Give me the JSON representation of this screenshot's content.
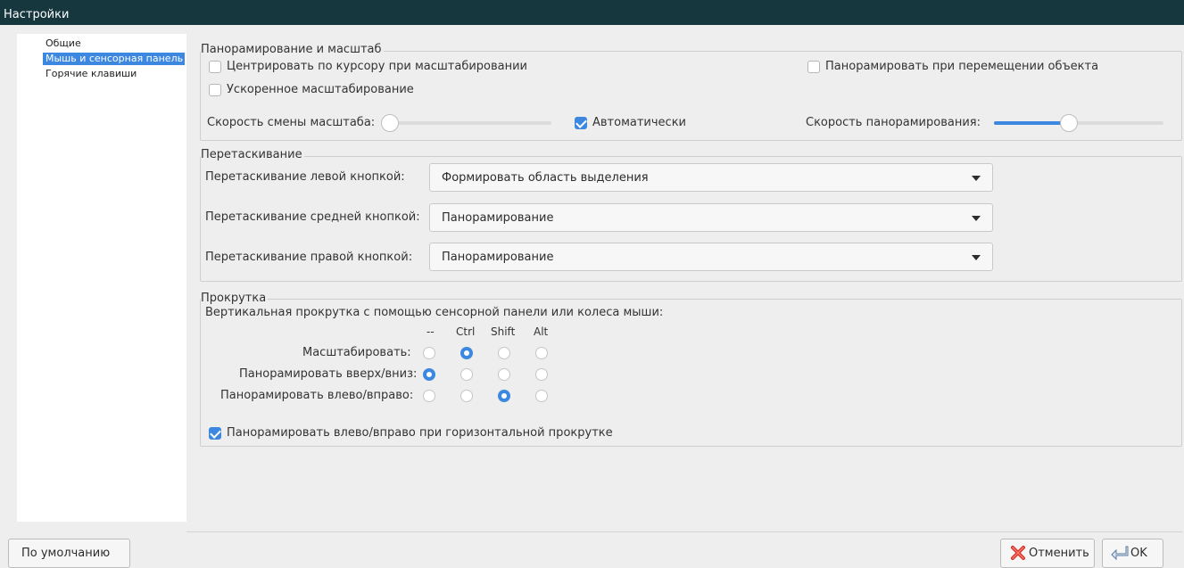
{
  "window": {
    "title": "Настройки"
  },
  "sidebar": {
    "items": [
      {
        "label": "Общие",
        "selected": false
      },
      {
        "label": "Мышь и сенсорная панель",
        "selected": true
      },
      {
        "label": "Горячие клавиши",
        "selected": false
      }
    ]
  },
  "pan_zoom": {
    "title": "Панорамирование и масштаб",
    "center_on_cursor": {
      "label": "Центрировать по курсору при масштабировании",
      "checked": false
    },
    "pan_on_move": {
      "label": "Панорамировать при перемещении объекта",
      "checked": false
    },
    "accelerated_zoom": {
      "label": "Ускоренное масштабирование",
      "checked": false
    },
    "zoom_speed": {
      "label": "Скорость смены масштаба:",
      "value": 0.0
    },
    "auto": {
      "label": "Автоматически",
      "checked": true
    },
    "pan_speed": {
      "label": "Скорость панорамирования:",
      "value": 0.45
    }
  },
  "drag": {
    "title": "Перетаскивание",
    "left": {
      "label": "Перетаскивание левой кнопкой:",
      "value": "Формировать область выделения"
    },
    "middle": {
      "label": "Перетаскивание средней кнопкой:",
      "value": "Панорамирование"
    },
    "right": {
      "label": "Перетаскивание правой кнопкой:",
      "value": "Панорамирование"
    }
  },
  "scroll": {
    "title": "Прокрутка",
    "subtitle": "Вертикальная прокрутка с помощью сенсорной панели или колеса мыши:",
    "columns": [
      "--",
      "Ctrl",
      "Shift",
      "Alt"
    ],
    "rows": [
      {
        "label": "Масштабировать:",
        "selected": 1
      },
      {
        "label": "Панорамировать вверх/вниз:",
        "selected": 0
      },
      {
        "label": "Панорамировать влево/вправо:",
        "selected": 2
      }
    ],
    "horizontal": {
      "label": "Панорамировать влево/вправо при горизонтальной прокрутке",
      "checked": true
    }
  },
  "buttons": {
    "defaults": "По умолчанию",
    "cancel": "Отменить",
    "ok": "OK"
  },
  "colors": {
    "accent": "#3c87e0",
    "titlebar": "#17373f",
    "cancel_icon": "#d0302a"
  }
}
